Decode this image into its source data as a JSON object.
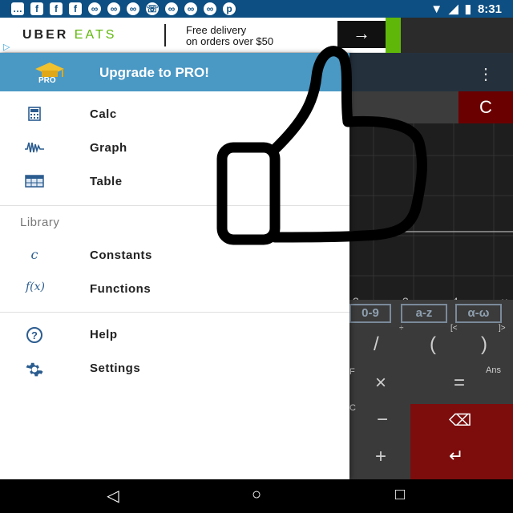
{
  "status_bar": {
    "time": "8:31",
    "notification_icons": [
      "chat-icon",
      "facebook-icon",
      "facebook-icon",
      "facebook-icon",
      "glasses-icon",
      "glasses-icon",
      "glasses-icon",
      "whatsapp-icon",
      "glasses-icon",
      "glasses-icon",
      "glasses-icon",
      "pinterest-icon"
    ]
  },
  "ad": {
    "brand_uber": "UBER",
    "brand_eats": "EATS",
    "line1": "Free delivery",
    "line2": "on orders over $50",
    "cta_icon": "arrow-right-icon",
    "cta_glyph": "→"
  },
  "drawer": {
    "header_title": "Upgrade to PRO!",
    "badge": "PRO",
    "items": [
      {
        "label": "Calc",
        "icon": "calculator-icon"
      },
      {
        "label": "Graph",
        "icon": "graph-icon"
      },
      {
        "label": "Table",
        "icon": "table-icon"
      }
    ],
    "library_heading": "Library",
    "library_items": [
      {
        "label": "Constants",
        "icon": "constant-c-icon",
        "glyph": "c"
      },
      {
        "label": "Functions",
        "icon": "fx-icon",
        "glyph": "f(x)"
      }
    ],
    "bottom_items": [
      {
        "label": "Help",
        "icon": "help-icon",
        "glyph": "?"
      },
      {
        "label": "Settings",
        "icon": "gear-icon"
      }
    ]
  },
  "background_app": {
    "clear_label": "C",
    "axis_ticks": [
      "2",
      "3",
      "4",
      "x"
    ],
    "keyboard_tabs": [
      "0-9",
      "a-z",
      "α-ω"
    ],
    "key_labels": [
      "/",
      "(",
      ")",
      "×",
      "=",
      "−",
      "+"
    ],
    "small_labels": [
      "÷",
      "[<",
      "]>",
      "F",
      "Ans",
      "C"
    ]
  },
  "navbar": {
    "back": "◁",
    "home": "○",
    "recents": "□"
  },
  "colors": {
    "drawer_header": "#4a98c4",
    "status_bar": "#0d4f82",
    "accent_red": "#7d0c0c",
    "uber_green": "#5fb709"
  }
}
